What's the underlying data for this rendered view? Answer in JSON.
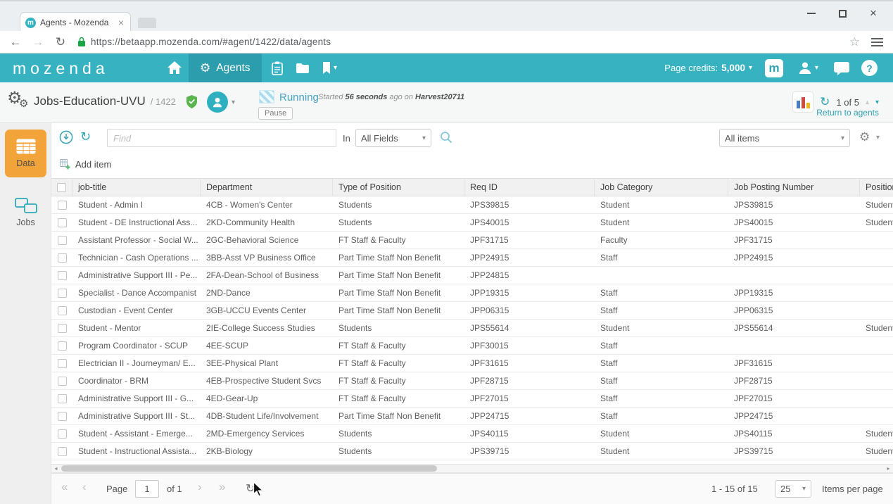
{
  "browser": {
    "tab_title": "Agents - Mozenda",
    "url": "https://betaapp.mozenda.com/#agent/1422/data/agents"
  },
  "header": {
    "logo": "mozenda",
    "brand_letter": "m",
    "agents_tab": "Agents",
    "page_credits_label": "Page credits:",
    "page_credits_value": "5,000"
  },
  "agent_bar": {
    "name": "Jobs-Education-UVU",
    "number": "/ 1422",
    "status": "Running",
    "pause": "Pause",
    "started_prefix": "Started",
    "started_time": "56 seconds",
    "started_mid": "ago on",
    "started_host": "Harvest20711",
    "counter": "1 of 5",
    "return_link": "Return to agents"
  },
  "sidebar": {
    "data_label": "Data",
    "jobs_label": "Jobs"
  },
  "toolbar": {
    "find_placeholder": "Find",
    "in_label": "In",
    "fields_value": "All Fields",
    "items_value": "All items"
  },
  "grid": {
    "add_item": "Add item",
    "columns": [
      "job-title",
      "Department",
      "Type of Position",
      "Req ID",
      "Job Category",
      "Job Posting Number",
      "Position"
    ],
    "rows": [
      [
        "Student - Admin I",
        "4CB - Women's Center",
        "Students",
        "JPS39815",
        "Student",
        "JPS39815",
        "Student"
      ],
      [
        "Student - DE Instructional Ass...",
        "2KD-Community Health",
        "Students",
        "JPS40015",
        "Student",
        "JPS40015",
        "Student"
      ],
      [
        "Assistant Professor - Social W...",
        "2GC-Behavioral Science",
        "FT Staff & Faculty",
        "JPF31715",
        "Faculty",
        "JPF31715",
        ""
      ],
      [
        "Technician - Cash Operations ...",
        "3BB-Asst VP Business Office",
        "Part Time Staff Non Benefit",
        "JPP24915",
        "Staff",
        "JPP24915",
        ""
      ],
      [
        "Administrative Support III - Pe...",
        "2FA-Dean-School of Business",
        "Part Time Staff Non Benefit",
        "JPP24815",
        "",
        "",
        ""
      ],
      [
        "Specialist - Dance Accompanist",
        "2ND-Dance",
        "Part Time Staff Non Benefit",
        "JPP19315",
        "Staff",
        "JPP19315",
        ""
      ],
      [
        "Custodian - Event Center",
        "3GB-UCCU Events Center",
        "Part Time Staff Non Benefit",
        "JPP06315",
        "Staff",
        "JPP06315",
        ""
      ],
      [
        "Student - Mentor",
        "2IE-College Success Studies",
        "Students",
        "JPS55614",
        "Student",
        "JPS55614",
        "Student"
      ],
      [
        "Program Coordinator - SCUP",
        "4EE-SCUP",
        "FT Staff & Faculty",
        "JPF30015",
        "Staff",
        "",
        ""
      ],
      [
        "Electrician II - Journeyman/ E...",
        "3EE-Physical Plant",
        "FT Staff & Faculty",
        "JPF31615",
        "Staff",
        "JPF31615",
        ""
      ],
      [
        "Coordinator - BRM",
        "4EB-Prospective Student Svcs",
        "FT Staff & Faculty",
        "JPF28715",
        "Staff",
        "JPF28715",
        ""
      ],
      [
        "Administrative Support III - G...",
        "4ED-Gear-Up",
        "FT Staff & Faculty",
        "JPF27015",
        "Staff",
        "JPF27015",
        ""
      ],
      [
        "Administrative Support III - St...",
        "4DB-Student Life/Involvement",
        "Part Time Staff Non Benefit",
        "JPP24715",
        "Staff",
        "JPP24715",
        ""
      ],
      [
        "Student - Assistant - Emerge...",
        "2MD-Emergency Services",
        "Students",
        "JPS40115",
        "Student",
        "JPS40115",
        "Student"
      ],
      [
        "Student - Instructional Assista...",
        "2KB-Biology",
        "Students",
        "JPS39715",
        "Student",
        "JPS39715",
        "Student"
      ]
    ]
  },
  "footer": {
    "page_label": "Page",
    "page_value": "1",
    "of_label": "of 1",
    "range": "1 - 15 of 15",
    "per_page": "25",
    "per_page_label": "Items per page"
  },
  "icons": {
    "gear": "⚙",
    "refresh": "↻",
    "star": "☆",
    "caret_down": "▾",
    "caret_up": "▴",
    "back_arrow": "←",
    "forward_arrow": "→",
    "first": "«",
    "prev": "‹",
    "next": "›",
    "last": "»",
    "close": "×",
    "scroll_left": "◂",
    "scroll_right": "▸",
    "help": "?"
  },
  "colors": {
    "teal": "#36b2c1",
    "teal_dark": "#2b9dac",
    "orange": "#f2a43a",
    "link": "#2fa3b4"
  }
}
